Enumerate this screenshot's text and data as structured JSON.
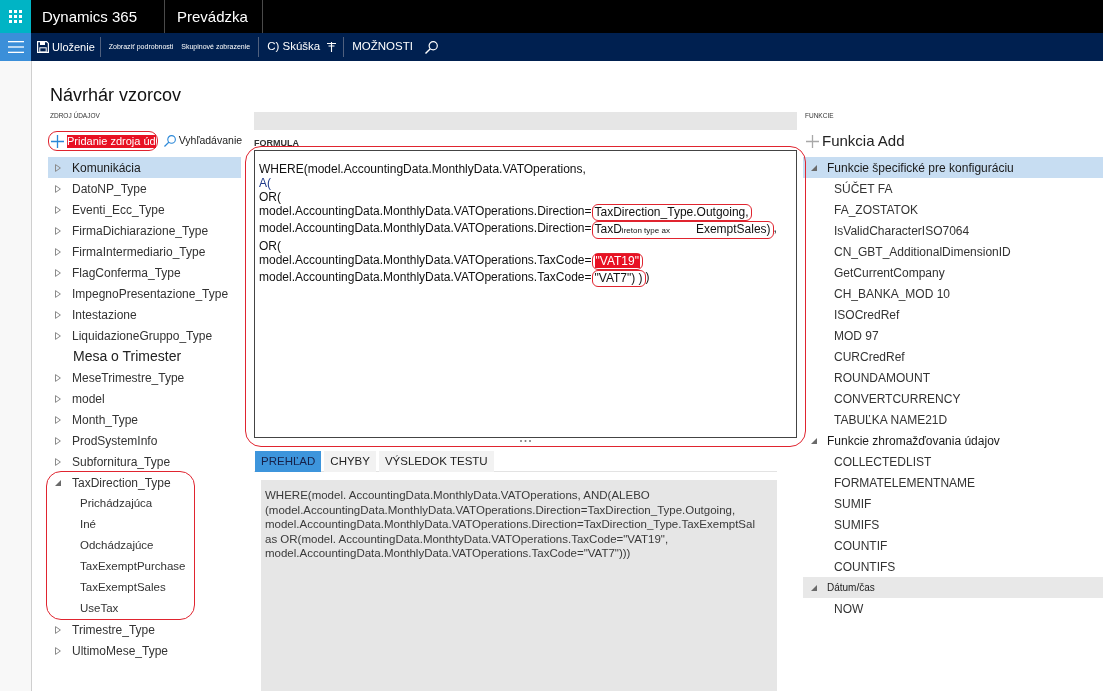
{
  "header": {
    "app_title": "Dynamics 365",
    "module": "Prevádzka"
  },
  "action_bar": {
    "items": [
      {
        "kind": "save",
        "label": "Uloženie"
      },
      {
        "kind": "divider"
      },
      {
        "kind": "small",
        "label": "Zobraziť podrobnosti"
      },
      {
        "kind": "small",
        "label": "Skupinové zobrazenie"
      },
      {
        "kind": "divider"
      },
      {
        "kind": "plain",
        "label": "C) Skúška"
      },
      {
        "kind": "pin"
      },
      {
        "kind": "divider"
      },
      {
        "kind": "plain",
        "label": "MOŽNOSTI"
      },
      {
        "kind": "search"
      }
    ]
  },
  "page_title": "Návrhár vzorcov",
  "data_sources": {
    "heading": "ZDROJ ÚDAJOV",
    "add_button": {
      "label": "Pridanie zdroja úd",
      "flagged": true,
      "outlined": true
    },
    "search_button": {
      "label": "Vyhľadávanie"
    },
    "tree": [
      {
        "label": "Komunikácia",
        "kind": "node",
        "expanded": false,
        "selected": true,
        "outlined": false
      },
      {
        "label": "DatoNP_Type",
        "kind": "node",
        "expanded": false,
        "selected": false,
        "outlined": false
      },
      {
        "label": "Eventi_Ecc_Type",
        "kind": "node",
        "expanded": false,
        "selected": false,
        "outlined": false
      },
      {
        "label": "FirmaDichiarazione_Type",
        "kind": "node",
        "expanded": false,
        "selected": false,
        "outlined": false
      },
      {
        "label": "FirmaIntermediario_Type",
        "kind": "node",
        "expanded": false,
        "selected": false,
        "outlined": false
      },
      {
        "label": "FlagConferma_Type",
        "kind": "node",
        "expanded": false,
        "selected": false,
        "outlined": false
      },
      {
        "label": "ImpegnoPresentazione_Type",
        "kind": "node",
        "expanded": false,
        "selected": false,
        "outlined": false
      },
      {
        "label": "Intestazione",
        "kind": "node",
        "expanded": false,
        "selected": false,
        "outlined": false
      },
      {
        "label": "LiquidazioneGruppo_Type",
        "kind": "node",
        "expanded": false,
        "selected": false,
        "outlined": false
      },
      {
        "label": "Mesa o Trimester",
        "kind": "plain",
        "selected": false,
        "outlined": false
      },
      {
        "label": "MeseTrimestre_Type",
        "kind": "node",
        "expanded": false,
        "selected": false,
        "outlined": false
      },
      {
        "label": "model",
        "kind": "node",
        "expanded": false,
        "selected": false,
        "outlined": false
      },
      {
        "label": "Month_Type",
        "kind": "node",
        "expanded": false,
        "selected": false,
        "outlined": false
      },
      {
        "label": "ProdSystemInfo",
        "kind": "node",
        "expanded": false,
        "selected": false,
        "outlined": false
      },
      {
        "label": "Subfornitura_Type",
        "kind": "node",
        "expanded": false,
        "selected": false,
        "outlined": false
      },
      {
        "label": "TaxDirection_Type",
        "kind": "node",
        "expanded": true,
        "selected": false,
        "outlined": true,
        "children": [
          {
            "label": "Prichádzajúca",
            "selected": false
          },
          {
            "label": "Iné",
            "selected": false
          },
          {
            "label": "Odchádzajúce",
            "selected": false
          },
          {
            "label": "TaxExemptPurchase",
            "selected": false
          },
          {
            "label": "TaxExemptSales",
            "selected": false
          },
          {
            "label": "UseTax",
            "selected": false
          }
        ]
      },
      {
        "label": "Trimestre_Type",
        "kind": "node",
        "expanded": false,
        "selected": false,
        "outlined": false
      },
      {
        "label": "UltimoMese_Type",
        "kind": "node",
        "expanded": false,
        "selected": false,
        "outlined": false
      }
    ]
  },
  "formula": {
    "heading": "FORMULA",
    "outlined": true,
    "lines": [
      {
        "segments": [
          {
            "kind": "plain",
            "text": "WHERE(model.AccountingData.MonthlyData.VATOperations,"
          }
        ]
      },
      {
        "segments": [
          {
            "kind": "accent",
            "text": "A("
          }
        ]
      },
      {
        "segments": [
          {
            "kind": "plain",
            "text": "OR("
          }
        ]
      },
      {
        "segments": [
          {
            "kind": "plain",
            "text": "model.AccountingData.MonthlyData.VATOperations.Direction="
          },
          {
            "kind": "boxed",
            "text": "TaxDirection_Type.Outgoing,"
          }
        ]
      },
      {
        "segments": [
          {
            "kind": "plain",
            "text": "model.AccountingData.MonthlyData.VATOperations.Direction="
          },
          {
            "kind": "boxed",
            "text": "TaxD"
          },
          {
            "kind": "boxed_small",
            "text": "ireton type ax"
          },
          {
            "kind": "boxed",
            "text": "ExemptSales)"
          },
          {
            "kind": "plain",
            "text": ","
          }
        ]
      },
      {
        "segments": [
          {
            "kind": "plain",
            "text": "OR("
          }
        ]
      },
      {
        "segments": [
          {
            "kind": "plain",
            "text": "model.AccountingData.MonthlyData.VATOperations.TaxCode="
          },
          {
            "kind": "boxed_flag",
            "text": "\"VAT19\""
          }
        ]
      },
      {
        "segments": [
          {
            "kind": "plain",
            "text": "model.AccountingData.MonthlyData.VATOperations.TaxCode="
          },
          {
            "kind": "boxed",
            "text": "\"VAT7\") )"
          },
          {
            "kind": "plain",
            "text": ")"
          }
        ]
      }
    ]
  },
  "result_tabs": [
    {
      "label": "PREHĽAD",
      "selected": true
    },
    {
      "label": "CHYBY",
      "selected": false
    },
    {
      "label": "VÝSLEDOK TESTU",
      "selected": false
    }
  ],
  "preview": {
    "lines": [
      "WHERE(model. AccountingData.MonthlyData.VATOperations, AND(ALEBO",
      "(model.AccountingData.MonthlyData.VATOperations.Direction=TaxDirection_Type.Outgoing,",
      "model.AccountingData.MonthlyData.VATOperations.Direction=TaxDirection_Type.TaxExemptSal",
      "as OR(model. AccountingData.MonthtyData.VATOperations.TaxCode=\"VAT19\",",
      "model.AccountingData.MonthlyData.VATOperations.TaxCode=\"VAT7\")))"
    ]
  },
  "functions": {
    "heading": "FUNKCIE",
    "add_button": {
      "label": "Funkcia Add"
    },
    "groups": [
      {
        "label": "Funkcie špecifické pre konfiguráciu",
        "kind": "category",
        "expanded": true,
        "selected": true,
        "items": [
          {
            "label": "SÚČET FA",
            "selected": false
          },
          {
            "label": "FA_ZOSTATOK",
            "selected": false
          },
          {
            "label": "IsValidCharacterISO7064",
            "selected": false
          },
          {
            "label": "CN_GBT_AdditionalDimensionID",
            "selected": false
          },
          {
            "label": "GetCurrentCompany",
            "selected": false
          },
          {
            "label": "CH_BANKA_MOD 10",
            "selected": false
          },
          {
            "label": "ISOCredRef",
            "selected": false
          },
          {
            "label": "MOD 97",
            "selected": false
          },
          {
            "label": "CURCredRef",
            "selected": false
          },
          {
            "label": "ROUNDAMOUNT",
            "selected": false
          },
          {
            "label": "CONVERTCURRENCY",
            "selected": false
          },
          {
            "label": "TABUĽKA NAME21D",
            "selected": false
          }
        ]
      },
      {
        "label": "Funkcie zhromažďovania údajov",
        "kind": "category",
        "expanded": true,
        "selected": false,
        "items": [
          {
            "label": "COLLECTEDLIST",
            "selected": false
          },
          {
            "label": "FORMATELEMENTNAME",
            "selected": false
          },
          {
            "label": "SUMIF",
            "selected": false
          },
          {
            "label": "SUMIFS",
            "selected": false
          },
          {
            "label": "COUNTIF",
            "selected": false
          },
          {
            "label": "COUNTIFS",
            "selected": false
          }
        ]
      },
      {
        "label": "Dátum/čas",
        "kind": "section",
        "expanded": true,
        "selected": false,
        "items": [
          {
            "label": "NOW",
            "selected": false
          }
        ]
      }
    ]
  }
}
